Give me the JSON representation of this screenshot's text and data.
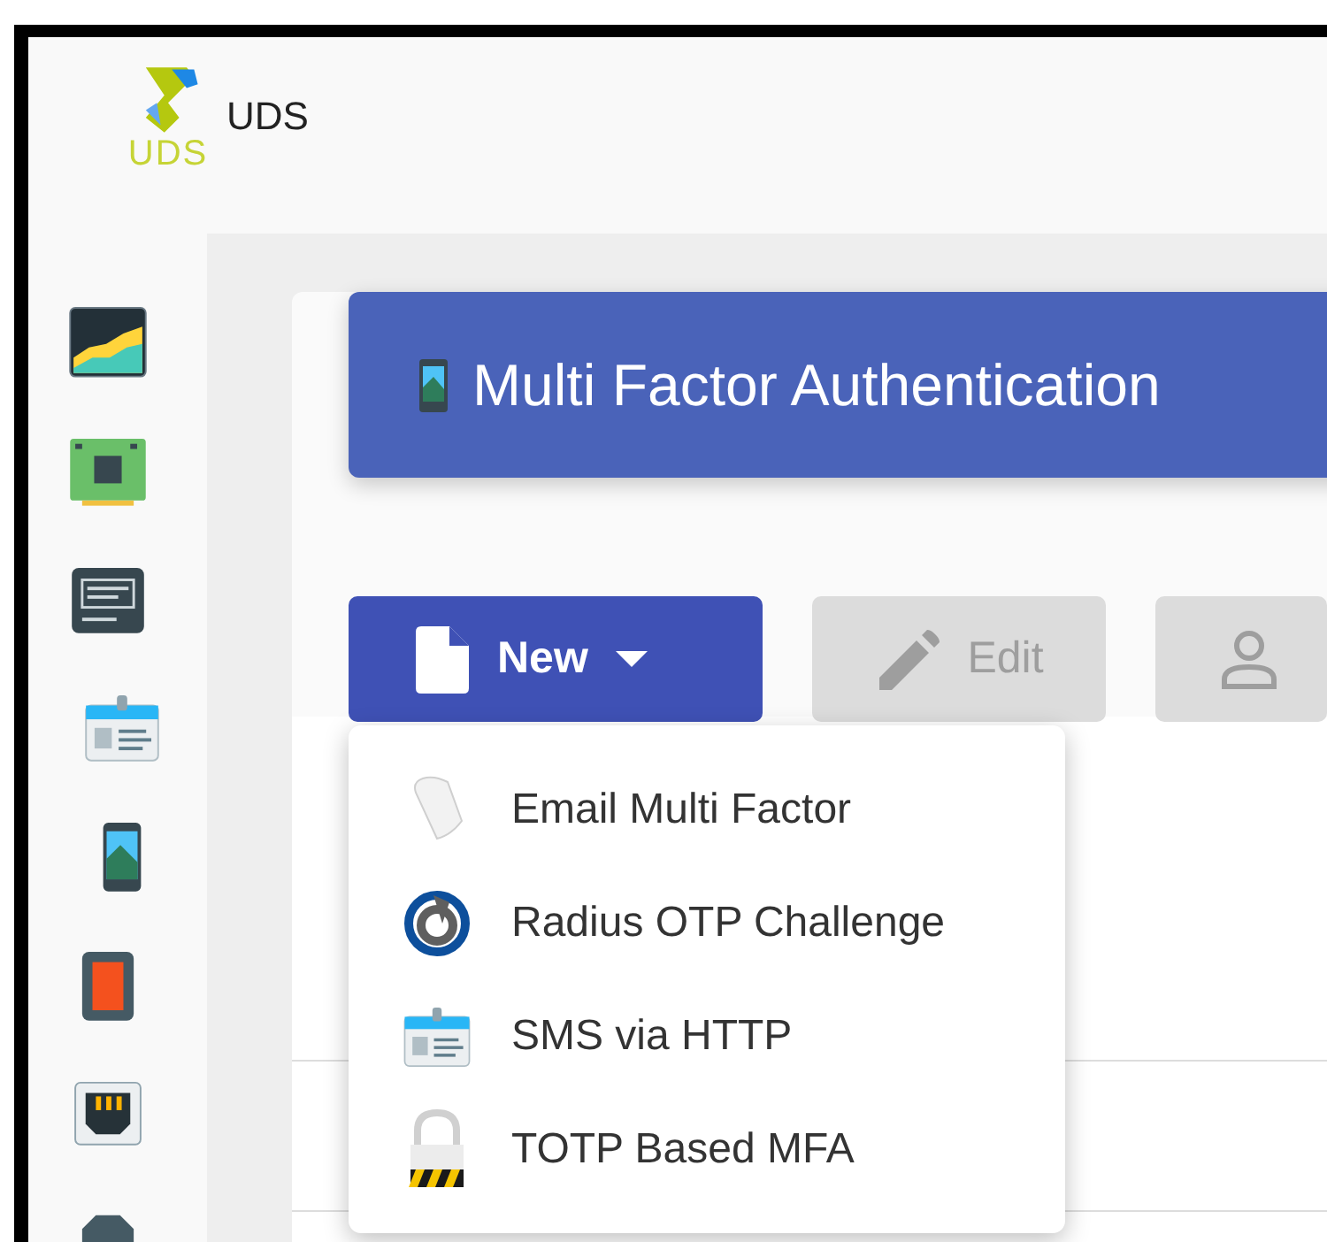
{
  "header": {
    "logo_text": "UDS",
    "app_name": "UDS"
  },
  "page": {
    "title": "Multi Factor Authentication"
  },
  "toolbar": [
    {
      "kind": "new",
      "label": "New",
      "disabled": false
    },
    {
      "kind": "edit",
      "label": "Edit",
      "disabled": true
    },
    {
      "kind": "permissions",
      "disabled": true
    }
  ],
  "new_menu": {
    "open": true,
    "items": [
      {
        "kind": "email",
        "label": "Email Multi Factor"
      },
      {
        "kind": "radius",
        "label": "Radius OTP Challenge"
      },
      {
        "kind": "sms",
        "label": "SMS via HTTP"
      },
      {
        "kind": "totp",
        "label": "TOTP Based MFA"
      }
    ]
  }
}
